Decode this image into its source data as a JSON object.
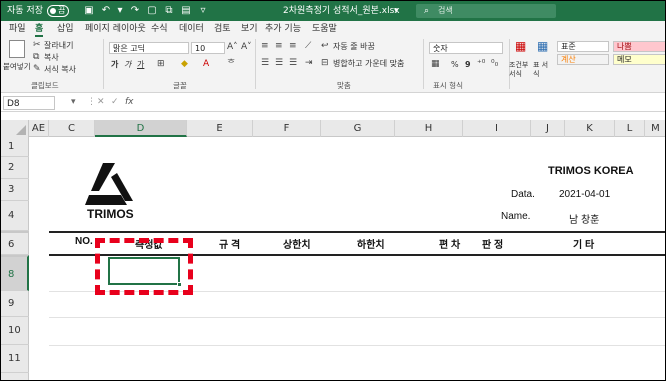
{
  "titlebar": {
    "autosave_label": "자동 저장",
    "autosave_state": "끔",
    "filename": "2차원측정기 성적서_원본.xlsx",
    "filename_suffix": "▾",
    "search_placeholder": "검색"
  },
  "menu": [
    "파일",
    "홈",
    "삽입",
    "페이지 레이아웃",
    "수식",
    "데이터",
    "검토",
    "보기",
    "추가 기능",
    "도움말"
  ],
  "ribbon": {
    "clipboard": {
      "paste": "붙여넣기",
      "cut": "잘라내기",
      "copy": "복사",
      "format_painter": "서식 복사",
      "group": "클립보드"
    },
    "font": {
      "name": "맑은 고딕",
      "size": "10",
      "bold": "가",
      "italic": "가",
      "underline": "가",
      "group": "글꼴"
    },
    "alignment": {
      "wrap": "자동 줄 바꿈",
      "merge": "병합하고 가운데 맞춤",
      "group": "맞춤"
    },
    "number": {
      "format": "숫자",
      "percent": "%",
      "comma": "9",
      "group": "표시 형식"
    },
    "styles": {
      "conditional": "조건부 서식",
      "table": "표 서식",
      "normal": "표준",
      "bad": "나쁨",
      "calc": "계산",
      "memo": "메모"
    }
  },
  "formula_bar": {
    "name_box": "D8",
    "fx": "fx",
    "formula": ""
  },
  "colors": {
    "excel_green": "#217346",
    "selection": "#217346",
    "highlight_red": "#e8001c"
  },
  "columns": [
    "AE",
    "C",
    "D",
    "E",
    "F",
    "G",
    "H",
    "I",
    "J",
    "K",
    "L",
    "M"
  ],
  "rows": [
    "1",
    "2",
    "3",
    "4",
    "6",
    "8",
    "9",
    "10",
    "11"
  ],
  "selected_cell": "D8",
  "sheet": {
    "logo_text": "TRIMOS",
    "company": "TRIMOS KOREA",
    "date_label": "Data.",
    "date_value": "2021-04-01",
    "name_label": "Name.",
    "name_value": "남 창훈",
    "headers": [
      "NO.",
      "측정값",
      "규 격",
      "상한치",
      "하한치",
      "편 차",
      "판 정",
      "기 타"
    ]
  }
}
